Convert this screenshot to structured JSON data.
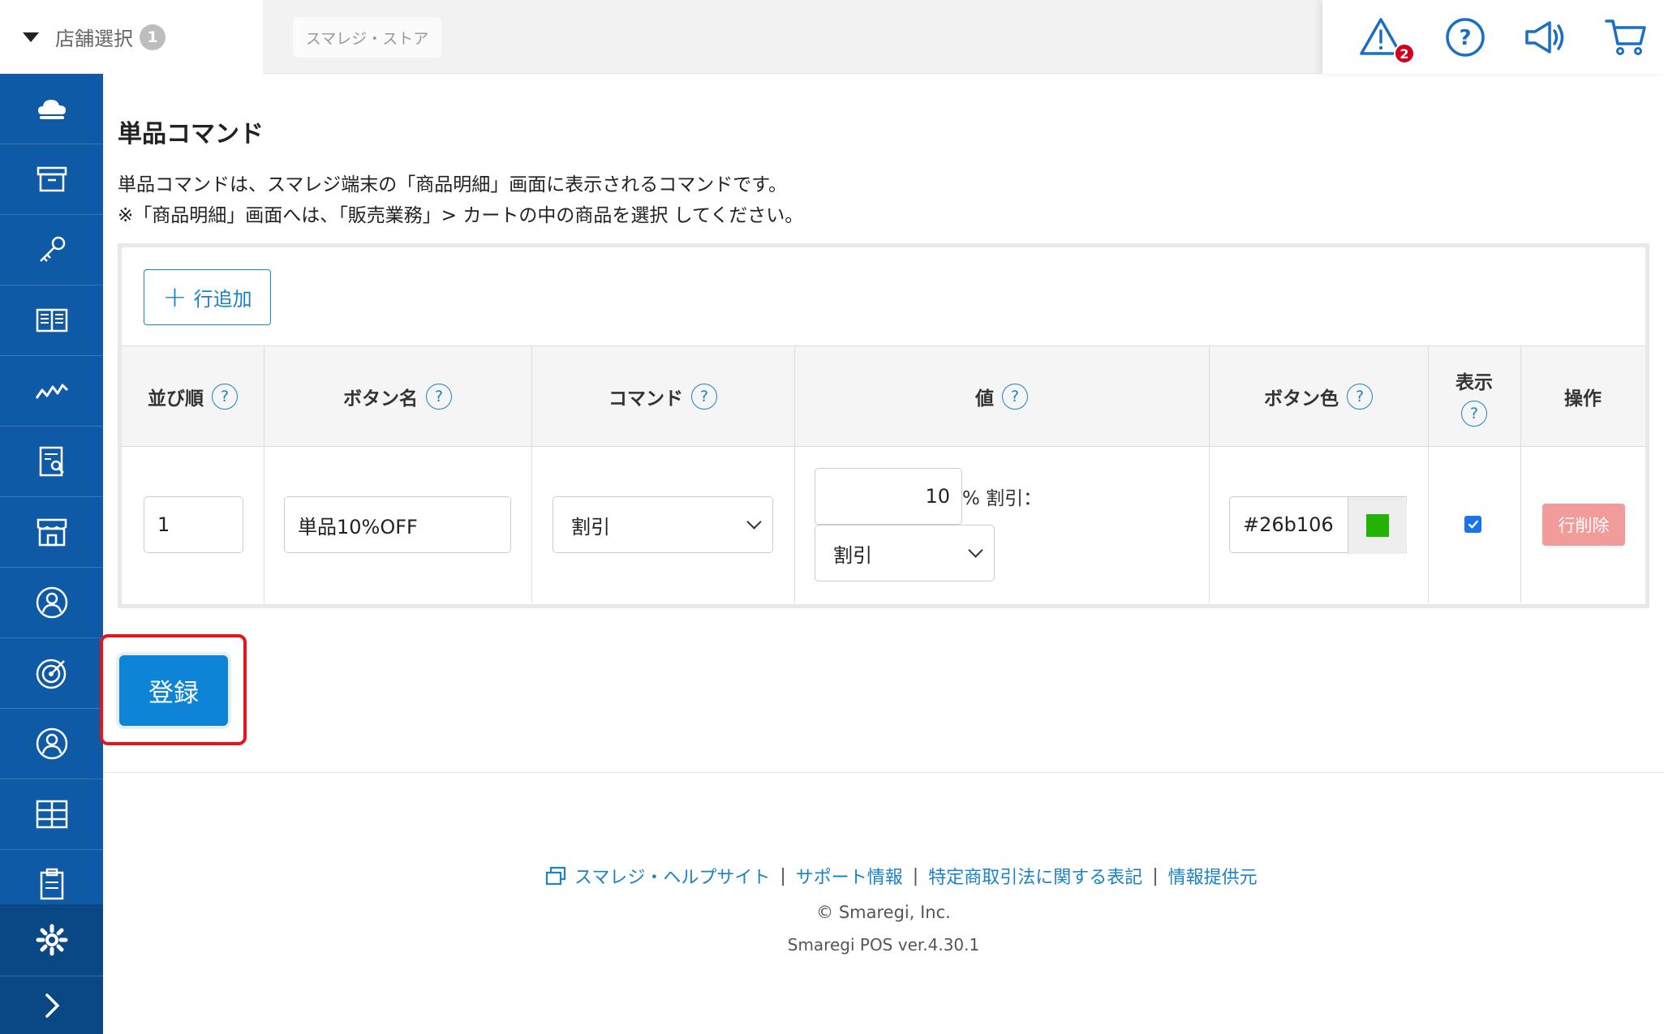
{
  "header": {
    "store_select_label": "店舗選択",
    "store_count": "1",
    "store_name": "スマレジ・ストア",
    "alert_count": "2",
    "icons": [
      "warning-icon",
      "help-icon",
      "megaphone-icon",
      "cart-icon"
    ]
  },
  "sidebar": {
    "icons": [
      "cloud-icon",
      "archive-icon",
      "key-icon",
      "book-icon",
      "chart-icon",
      "report-icon",
      "store-icon",
      "customer-icon",
      "target-icon",
      "user-icon",
      "grid-icon",
      "clipboard-icon",
      "gear-icon",
      "chevron-right-icon"
    ]
  },
  "main": {
    "title": "単品コマンド",
    "desc_line1": "単品コマンドは、スマレジ端末の「商品明細」画面に表示されるコマンドです。",
    "desc_line2": "※「商品明細」画面へは、「販売業務」> カートの中の商品を選択 してください。",
    "add_row_label": "行追加",
    "columns": {
      "order": "並び順",
      "button_name": "ボタン名",
      "command": "コマンド",
      "value": "値",
      "button_color": "ボタン色",
      "display": "表示",
      "operation": "操作"
    },
    "help_mark": "?",
    "row": {
      "order": "1",
      "button_name": "単品10%OFF",
      "command": "割引",
      "value_number": "10",
      "value_suffix": "% 割引：",
      "value_type": "割引",
      "color_hex": "#26b106",
      "display_checked": true,
      "delete_label": "行削除"
    },
    "register_label": "登録"
  },
  "footer": {
    "links": [
      "スマレジ・ヘルプサイト",
      "サポート情報",
      "特定商取引法に関する表記",
      "情報提供元"
    ],
    "copyright": "© Smaregi, Inc.",
    "version": "Smaregi POS ver.4.30.1"
  },
  "colors": {
    "sidebar": "#0e5aa7",
    "accent": "#1a82c9",
    "primary_button": "#0d84d6",
    "delete_button": "#f29b9b",
    "highlight": "#e8141c",
    "alert_badge": "#d0021b"
  }
}
